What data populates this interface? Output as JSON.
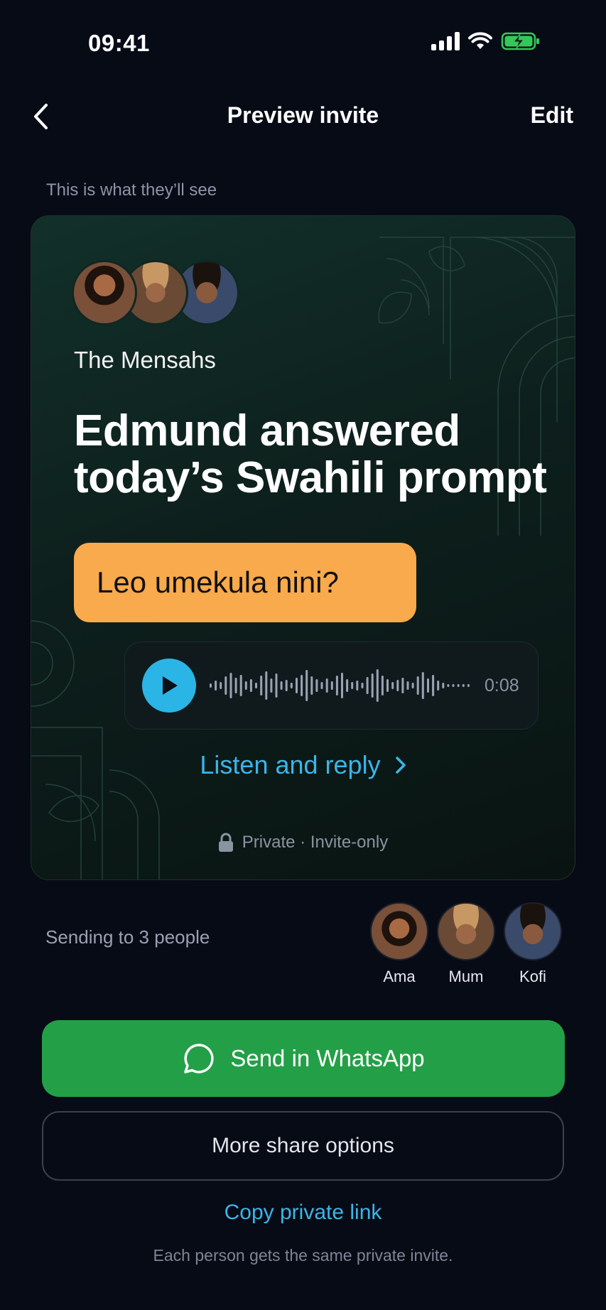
{
  "status_bar": {
    "time": "09:41"
  },
  "nav": {
    "title": "Preview invite",
    "edit_label": "Edit"
  },
  "caption": "This is what they’ll see",
  "card": {
    "family_name": "The Mensahs",
    "headline": "Edmund answered today’s Swahili prompt",
    "prompt": "Leo umekula nini?",
    "audio": {
      "duration": "0:08"
    },
    "listen_label": "Listen and reply",
    "privacy": "Private · Invite-only"
  },
  "recipients": {
    "label": "Sending to 3 people",
    "people": [
      {
        "name": "Ama"
      },
      {
        "name": "Mum"
      },
      {
        "name": "Kofi"
      }
    ]
  },
  "actions": {
    "whatsapp_label": "Send in WhatsApp",
    "more_label": "More share options",
    "copy_link_label": "Copy private link"
  },
  "footer_note": "Each person gets the same private invite.",
  "colors": {
    "background": "#070b16",
    "accent_blue": "#3bb5e8",
    "prompt_orange": "#f9aa4c",
    "whatsapp_green": "#23a047",
    "battery_green": "#35c759"
  },
  "icons": [
    "back-chevron-icon",
    "signal-icon",
    "wifi-icon",
    "battery-charging-icon",
    "play-icon",
    "chevron-right-icon",
    "lock-icon",
    "chat-bubble-icon"
  ]
}
